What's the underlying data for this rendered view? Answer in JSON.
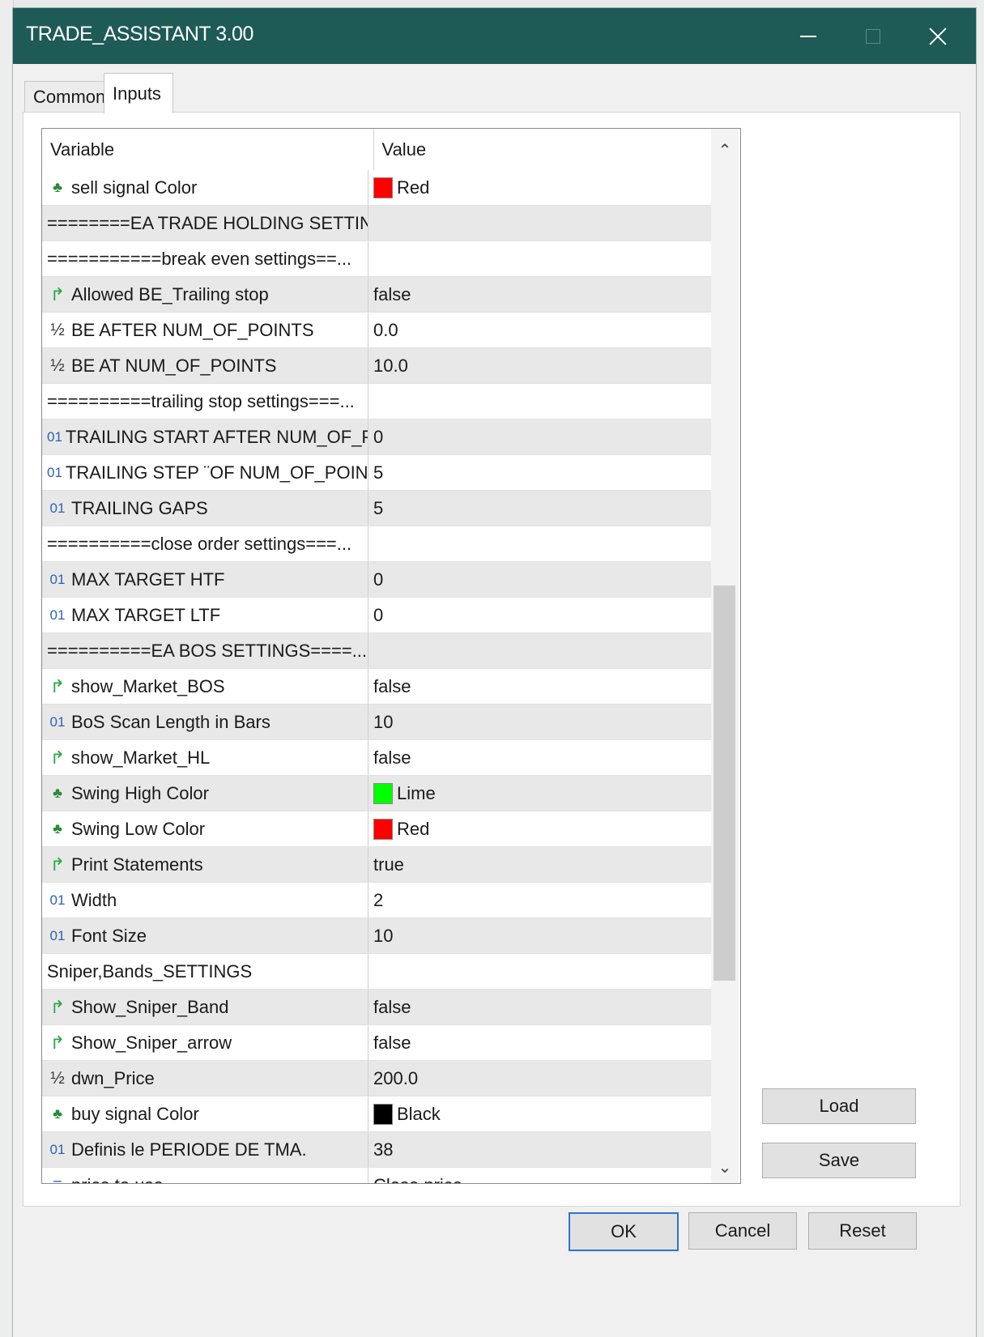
{
  "window": {
    "title": "TRADE_ASSISTANT 3.00"
  },
  "tabs": [
    {
      "label": "Common",
      "active": false
    },
    {
      "label": "Inputs",
      "active": true
    }
  ],
  "grid": {
    "headers": {
      "variable": "Variable",
      "value": "Value"
    },
    "rows": [
      {
        "icon": "color-icon",
        "variable": "sell signal Color",
        "value": "Red",
        "swatch": "#ff0000"
      },
      {
        "icon": "",
        "variable": "========EA TRADE HOLDING SETTIN...",
        "value": ""
      },
      {
        "icon": "",
        "variable": "===========break even settings==...",
        "value": ""
      },
      {
        "icon": "bool-icon",
        "variable": "Allowed BE_Trailing stop",
        "value": "false"
      },
      {
        "icon": "double-icon",
        "variable": "BE AFTER NUM_OF_POINTS",
        "value": "0.0"
      },
      {
        "icon": "double-icon",
        "variable": "BE AT NUM_OF_POINTS",
        "value": "10.0"
      },
      {
        "icon": "",
        "variable": "==========trailing stop settings===...",
        "value": ""
      },
      {
        "icon": "int-icon",
        "variable": "TRAILING START AFTER  NUM_OF_PO...",
        "value": "0"
      },
      {
        "icon": "int-icon",
        "variable": "TRAILING STEP ¨OF NUM_OF_POINTS",
        "value": "5"
      },
      {
        "icon": "int-icon",
        "variable": "TRAILING GAPS",
        "value": "5"
      },
      {
        "icon": "",
        "variable": "==========close order settings===...",
        "value": ""
      },
      {
        "icon": "int-icon",
        "variable": "MAX TARGET  HTF",
        "value": "0"
      },
      {
        "icon": "int-icon",
        "variable": "MAX TARGET LTF",
        "value": "0"
      },
      {
        "icon": "",
        "variable": "==========EA BOS SETTINGS====...",
        "value": ""
      },
      {
        "icon": "bool-icon",
        "variable": "show_Market_BOS",
        "value": "false"
      },
      {
        "icon": "int-icon",
        "variable": "BoS Scan Length in Bars",
        "value": "10"
      },
      {
        "icon": "bool-icon",
        "variable": "show_Market_HL",
        "value": "false"
      },
      {
        "icon": "color-icon",
        "variable": "Swing High Color",
        "value": "Lime",
        "swatch": "#00ff00"
      },
      {
        "icon": "color-icon",
        "variable": "Swing Low Color",
        "value": "Red",
        "swatch": "#ff0000"
      },
      {
        "icon": "bool-icon",
        "variable": "Print Statements",
        "value": "true"
      },
      {
        "icon": "int-icon",
        "variable": "Width",
        "value": "2"
      },
      {
        "icon": "int-icon",
        "variable": "Font Size",
        "value": "10"
      },
      {
        "icon": "",
        "variable": "Sniper,Bands_SETTINGS",
        "value": ""
      },
      {
        "icon": "bool-icon",
        "variable": "Show_Sniper_Band",
        "value": "false"
      },
      {
        "icon": "bool-icon",
        "variable": "Show_Sniper_arrow",
        "value": "false"
      },
      {
        "icon": "double-icon",
        "variable": "dwn_Price",
        "value": "200.0"
      },
      {
        "icon": "color-icon",
        "variable": "buy signal Color",
        "value": "Black",
        "swatch": "#000000"
      },
      {
        "icon": "int-icon",
        "variable": "Definis le PERIODE DE TMA.",
        "value": "38"
      },
      {
        "icon": "enum-icon",
        "variable": "price to use",
        "value": "Close price"
      }
    ]
  },
  "buttons": {
    "load": "Load",
    "save": "Save",
    "ok": "OK",
    "cancel": "Cancel",
    "reset": "Reset"
  },
  "icon_glyphs": {
    "color-icon": "♣",
    "bool-icon": "↱",
    "int-icon": "01",
    "double-icon": "½",
    "enum-icon": "≡"
  },
  "colors": {
    "titlebar": "#1e5a56",
    "focus": "#2a74d6"
  }
}
